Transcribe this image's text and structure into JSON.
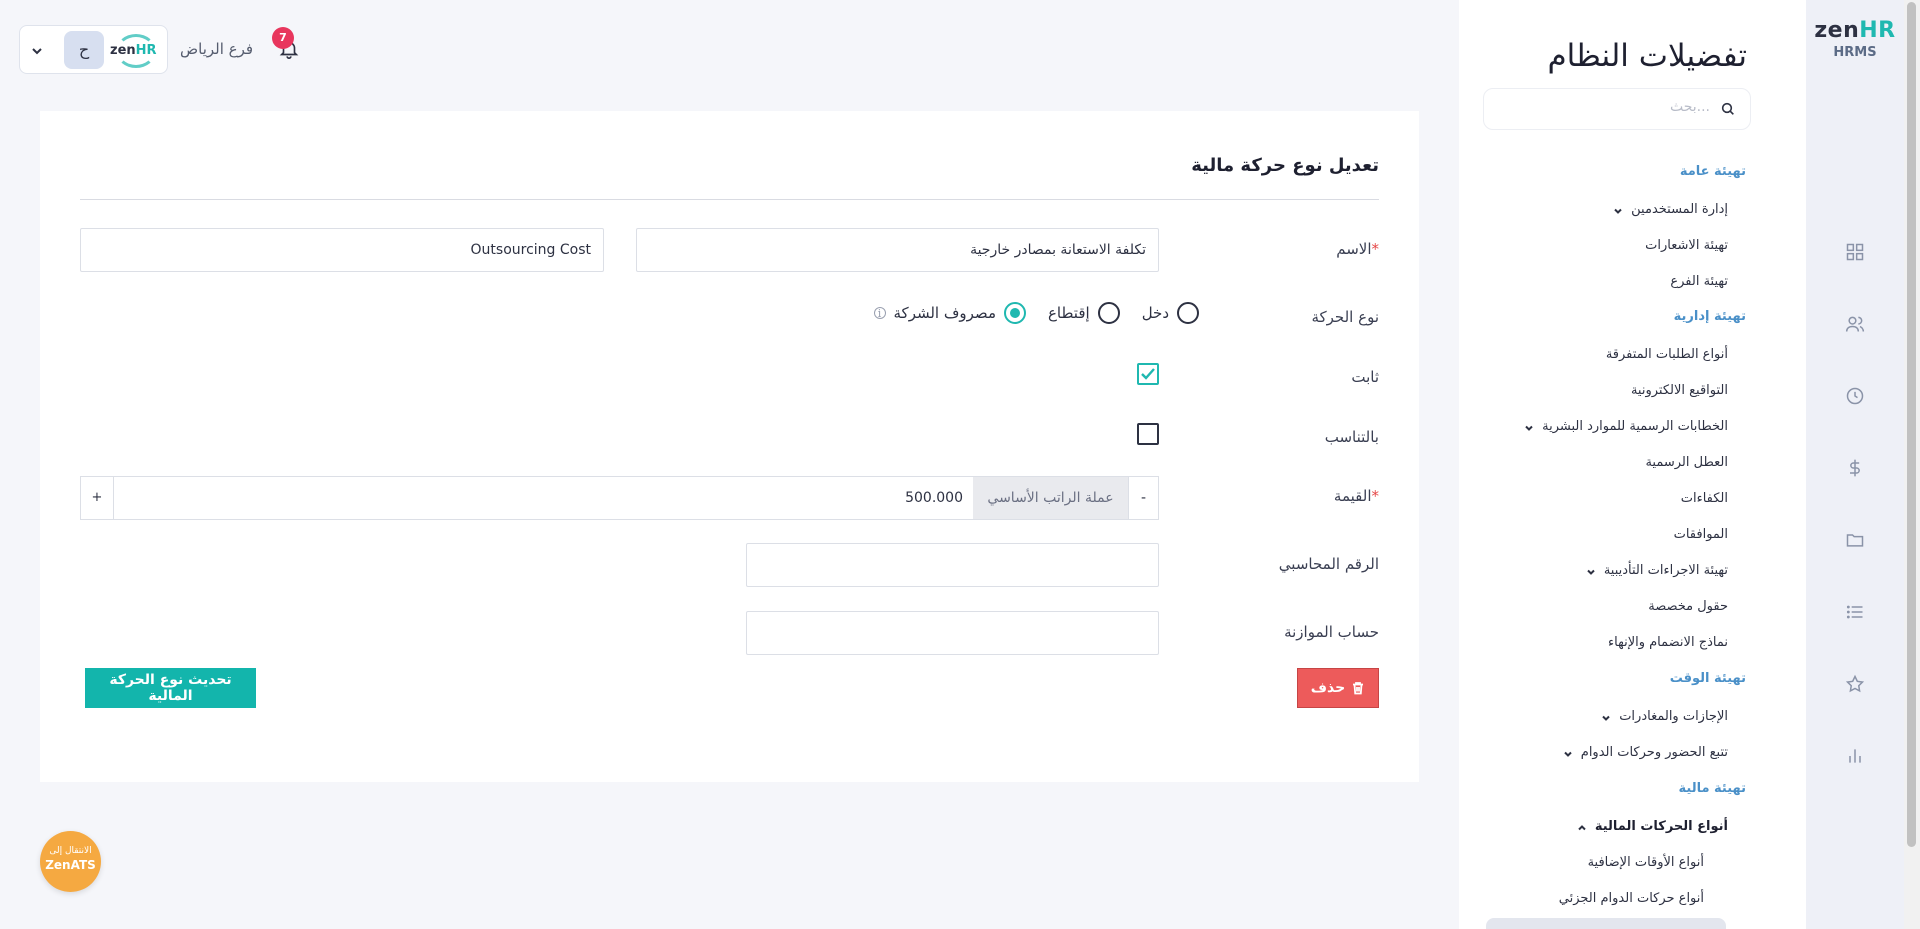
{
  "app": {
    "logo_text": "zen",
    "logo_accent": "HR",
    "logo_sub": "HRMS",
    "brand_color": "#1fb8b0"
  },
  "rail_icons": [
    "grid-icon",
    "users-icon",
    "clock-icon",
    "dollar-icon",
    "folder-icon",
    "list-icon",
    "star-icon",
    "bar-chart-icon"
  ],
  "settings": {
    "title": "تفضيلات النظام",
    "search_placeholder": "بحث...",
    "sections": [
      {
        "label": "تهيئة عامة"
      },
      {
        "label": "تهيئة إدارية"
      },
      {
        "label": "تهيئة الوقت"
      },
      {
        "label": "تهيئة مالية"
      }
    ],
    "items": [
      {
        "label": "إدارة المستخدمين",
        "chevron": "down"
      },
      {
        "label": "تهيئة الاشعارات"
      },
      {
        "label": "تهيئة الفرع"
      },
      {
        "label": "أنواع الطلبات المتفرقة"
      },
      {
        "label": "التواقيع الالكترونية"
      },
      {
        "label": "الخطابات الرسمية للموارد البشرية",
        "chevron": "down"
      },
      {
        "label": "العطل الرسمية"
      },
      {
        "label": "الكفاءات"
      },
      {
        "label": "الموافقات"
      },
      {
        "label": "تهيئة الاجراءات التأديبية",
        "chevron": "down"
      },
      {
        "label": "حقول مخصصة"
      },
      {
        "label": "نماذج الانضمام والإنهاء"
      },
      {
        "label": "الإجازات والمغادرات",
        "chevron": "down"
      },
      {
        "label": "تتبع الحضور وحركات الدوام",
        "chevron": "down"
      },
      {
        "label": "أنواع الحركات المالية",
        "chevron": "up",
        "active": true
      },
      {
        "label": "أنواع الأوقات الإضافية"
      },
      {
        "label": "أنواع حركات الدوام الجزئي"
      }
    ]
  },
  "topbar": {
    "avatar_initial": "ح",
    "company_logo_text": "zen",
    "company_logo_accent": "HR",
    "branch": "فرع الرياض",
    "notification_count": "7"
  },
  "form": {
    "title": "تعديل نوع حركة مالية",
    "name_label": "الاسم",
    "required_mark": "*",
    "name_ar": "تكلفة الاستعانة بمصادر خارجية",
    "name_en": "Outsourcing Cost",
    "type_label": "نوع الحركة",
    "type_options": [
      {
        "label": "دخل",
        "selected": false
      },
      {
        "label": "إقتطاع",
        "selected": false
      },
      {
        "label": "مصروف الشركة",
        "selected": true
      }
    ],
    "info_glyph": "i",
    "fixed_label": "ثابت",
    "fixed_checked": true,
    "prorated_label": "بالتناسب",
    "prorated_checked": false,
    "value_label": "القيمة",
    "value_minus": "-",
    "value_currency": "عملة الراتب الأساسي",
    "value_amount": "500.000",
    "value_plus": "+",
    "account_label": "الرقم المحاسبي",
    "account_value": "",
    "budget_label": "حساب الموازنة",
    "budget_value": "",
    "delete_label": "حذف",
    "update_label": "تحديث نوع الحركة المالية"
  },
  "zenats": {
    "line1": "الانتقال إلى",
    "line2": "ZenATS"
  }
}
